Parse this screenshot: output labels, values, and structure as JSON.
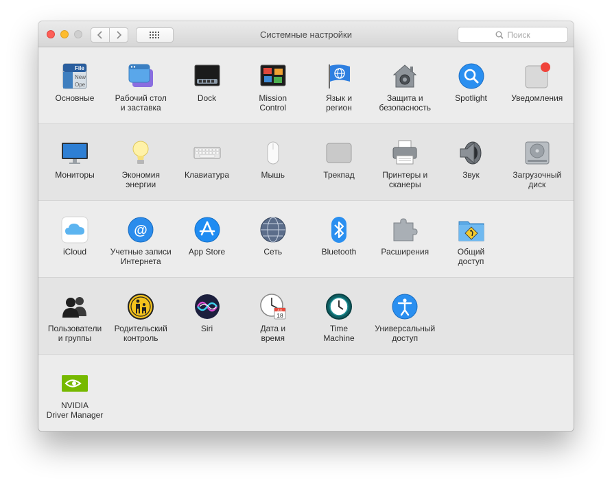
{
  "window": {
    "title": "Системные настройки",
    "search_placeholder": "Поиск"
  },
  "sections": [
    [
      {
        "label": "Основные",
        "icon": "general-icon"
      },
      {
        "label": "Рабочий стол\nи заставка",
        "icon": "desktop-screensaver-icon"
      },
      {
        "label": "Dock",
        "icon": "dock-icon"
      },
      {
        "label": "Mission\nControl",
        "icon": "mission-control-icon"
      },
      {
        "label": "Язык и\nрегион",
        "icon": "language-region-icon"
      },
      {
        "label": "Защита и\nбезопасность",
        "icon": "security-icon"
      },
      {
        "label": "Spotlight",
        "icon": "spotlight-icon"
      },
      {
        "label": "Уведомления",
        "icon": "notifications-icon"
      }
    ],
    [
      {
        "label": "Мониторы",
        "icon": "displays-icon"
      },
      {
        "label": "Экономия\nэнергии",
        "icon": "energy-saver-icon"
      },
      {
        "label": "Клавиатура",
        "icon": "keyboard-icon"
      },
      {
        "label": "Мышь",
        "icon": "mouse-icon"
      },
      {
        "label": "Трекпад",
        "icon": "trackpad-icon"
      },
      {
        "label": "Принтеры и\nсканеры",
        "icon": "printer-icon"
      },
      {
        "label": "Звук",
        "icon": "sound-icon"
      },
      {
        "label": "Загрузочный\nдиск",
        "icon": "startup-disk-icon"
      }
    ],
    [
      {
        "label": "iCloud",
        "icon": "icloud-icon"
      },
      {
        "label": "Учетные записи\nИнтернета",
        "icon": "internet-accounts-icon"
      },
      {
        "label": "App Store",
        "icon": "app-store-icon"
      },
      {
        "label": "Сеть",
        "icon": "network-icon"
      },
      {
        "label": "Bluetooth",
        "icon": "bluetooth-icon"
      },
      {
        "label": "Расширения",
        "icon": "extensions-icon"
      },
      {
        "label": "Общий\nдоступ",
        "icon": "sharing-icon"
      }
    ],
    [
      {
        "label": "Пользователи\nи группы",
        "icon": "users-groups-icon"
      },
      {
        "label": "Родительский\nконтроль",
        "icon": "parental-controls-icon"
      },
      {
        "label": "Siri",
        "icon": "siri-icon"
      },
      {
        "label": "Дата и\nвремя",
        "icon": "date-time-icon"
      },
      {
        "label": "Time\nMachine",
        "icon": "time-machine-icon"
      },
      {
        "label": "Универсальный\nдоступ",
        "icon": "accessibility-icon"
      }
    ],
    [
      {
        "label": "NVIDIA\nDriver Manager",
        "icon": "nvidia-icon"
      }
    ]
  ],
  "general_icon_text": [
    "File",
    "New",
    "Ope"
  ],
  "date_icon_text": {
    "month": "JUL",
    "day": "18"
  }
}
